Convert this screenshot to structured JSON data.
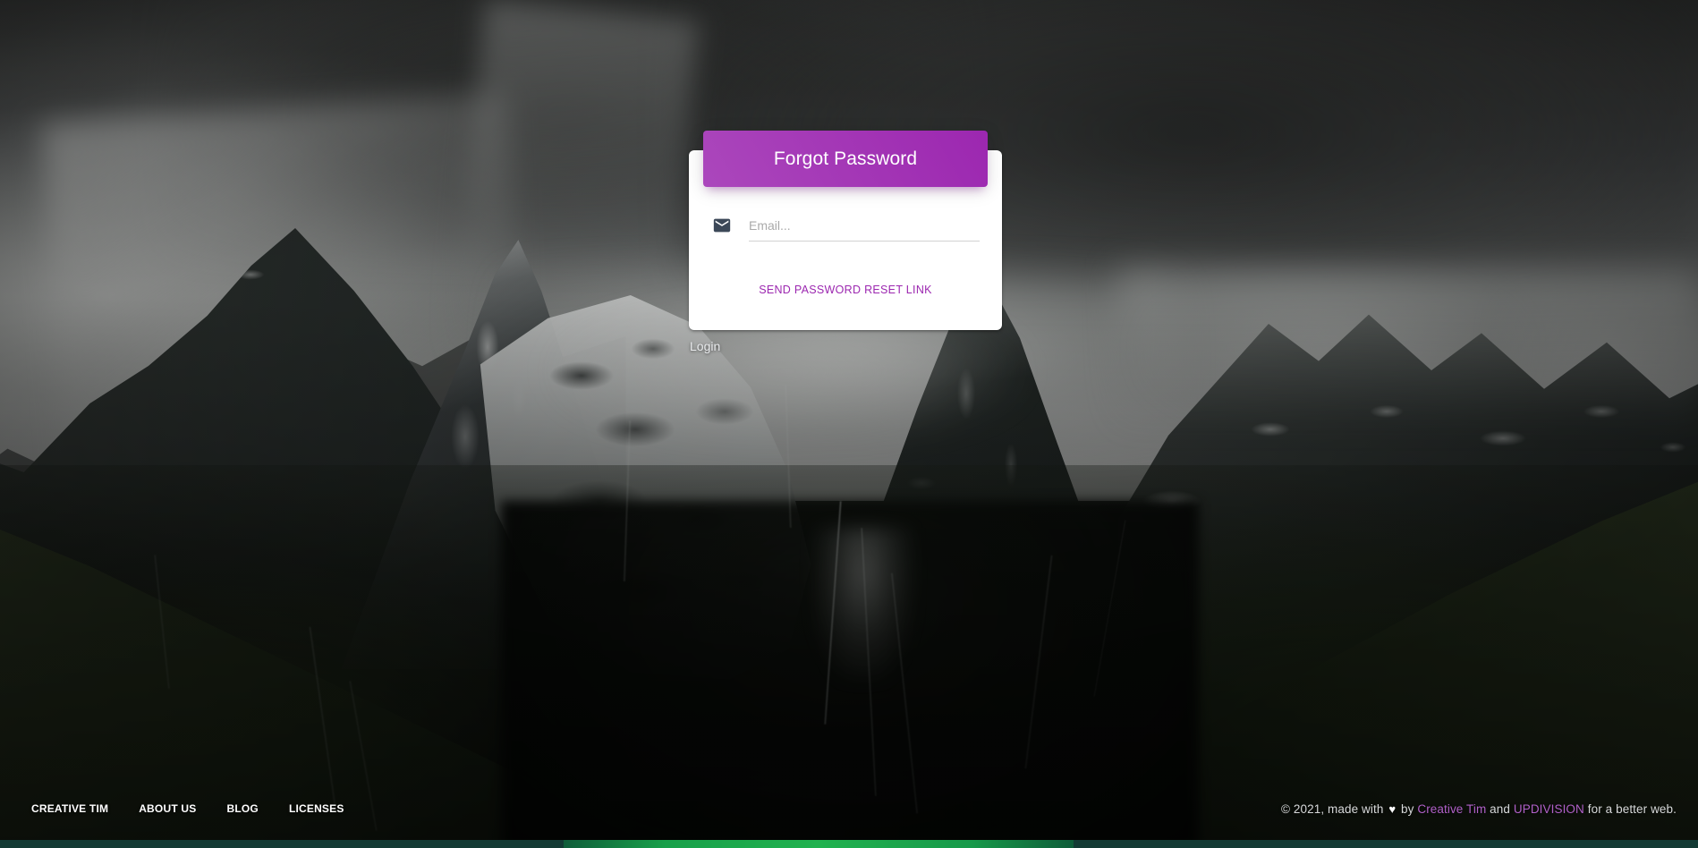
{
  "card": {
    "title": "Forgot Password",
    "email_field": {
      "icon": "mail-icon",
      "placeholder": "Email...",
      "value": ""
    },
    "submit_label": "Send Password Reset Link",
    "accent_color": "#9c27b0",
    "header_gradient_from": "#ab47bc",
    "header_gradient_to": "#9c27b0"
  },
  "login_link": {
    "label": "Login"
  },
  "footer": {
    "nav": [
      {
        "label": "Creative Tim"
      },
      {
        "label": "About Us"
      },
      {
        "label": "Blog"
      },
      {
        "label": "Licenses"
      }
    ],
    "copyright": {
      "prefix": "© 2021, made with",
      "heart": "♥",
      "by": "by",
      "link1": "Creative Tim",
      "and": "and",
      "link2": "UPDIVISION",
      "suffix": "for a better web.",
      "link_color": "#b060c8"
    }
  },
  "background": {
    "description": "Dark storm clouds over snow-capped mountain peaks with green valley"
  },
  "progress_bar": {
    "color": "#21b24f",
    "track_color": "#133a34"
  }
}
